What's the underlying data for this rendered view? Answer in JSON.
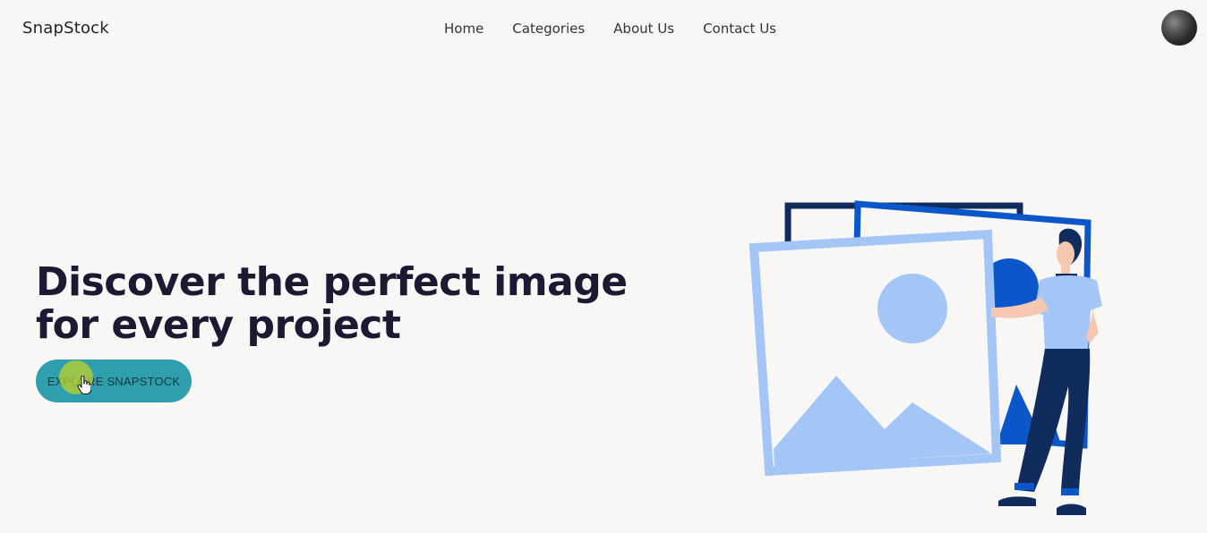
{
  "nav": {
    "brand": "SnapStock",
    "links": [
      "Home",
      "Categories",
      "About Us",
      "Contact Us"
    ]
  },
  "hero": {
    "title": "Discover the perfect image for every project",
    "cta_label": "EXPLORE SNAPSTOCK"
  },
  "illustration": {
    "name": "person-holding-image-frames",
    "colors": {
      "dark_navy": "#0f2c5c",
      "royal_blue": "#0b56c9",
      "light_blue": "#a4c6f7",
      "skin": "#f5c7b0"
    }
  },
  "colors": {
    "background": "#f9f7f6",
    "headline": "#1e1833",
    "cta_bg": "#2f9fae",
    "cursor_highlight": "#bed228"
  }
}
